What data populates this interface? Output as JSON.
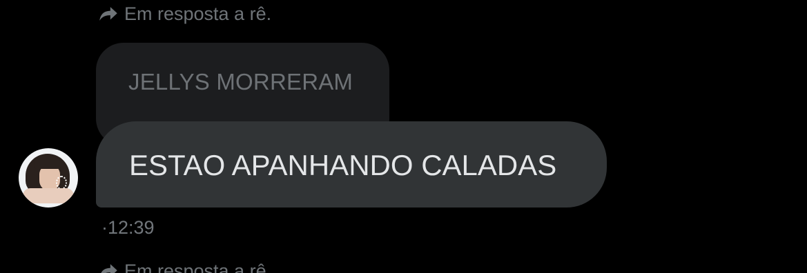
{
  "reply_header_top": {
    "text": "Em resposta a rê.",
    "icon": "reply-arrow-icon"
  },
  "quoted_message": {
    "text": "JELLYS MORRERAM"
  },
  "message": {
    "text": "ESTAO APANHANDO CALADAS",
    "timestamp": "·12:39"
  },
  "reply_header_bottom": {
    "text": "Em resposta a rê.",
    "icon": "reply-arrow-icon"
  },
  "colors": {
    "background": "#000000",
    "bubble": "#313436",
    "quoted_bubble": "#1c1d1f",
    "muted_text": "#71767b"
  }
}
